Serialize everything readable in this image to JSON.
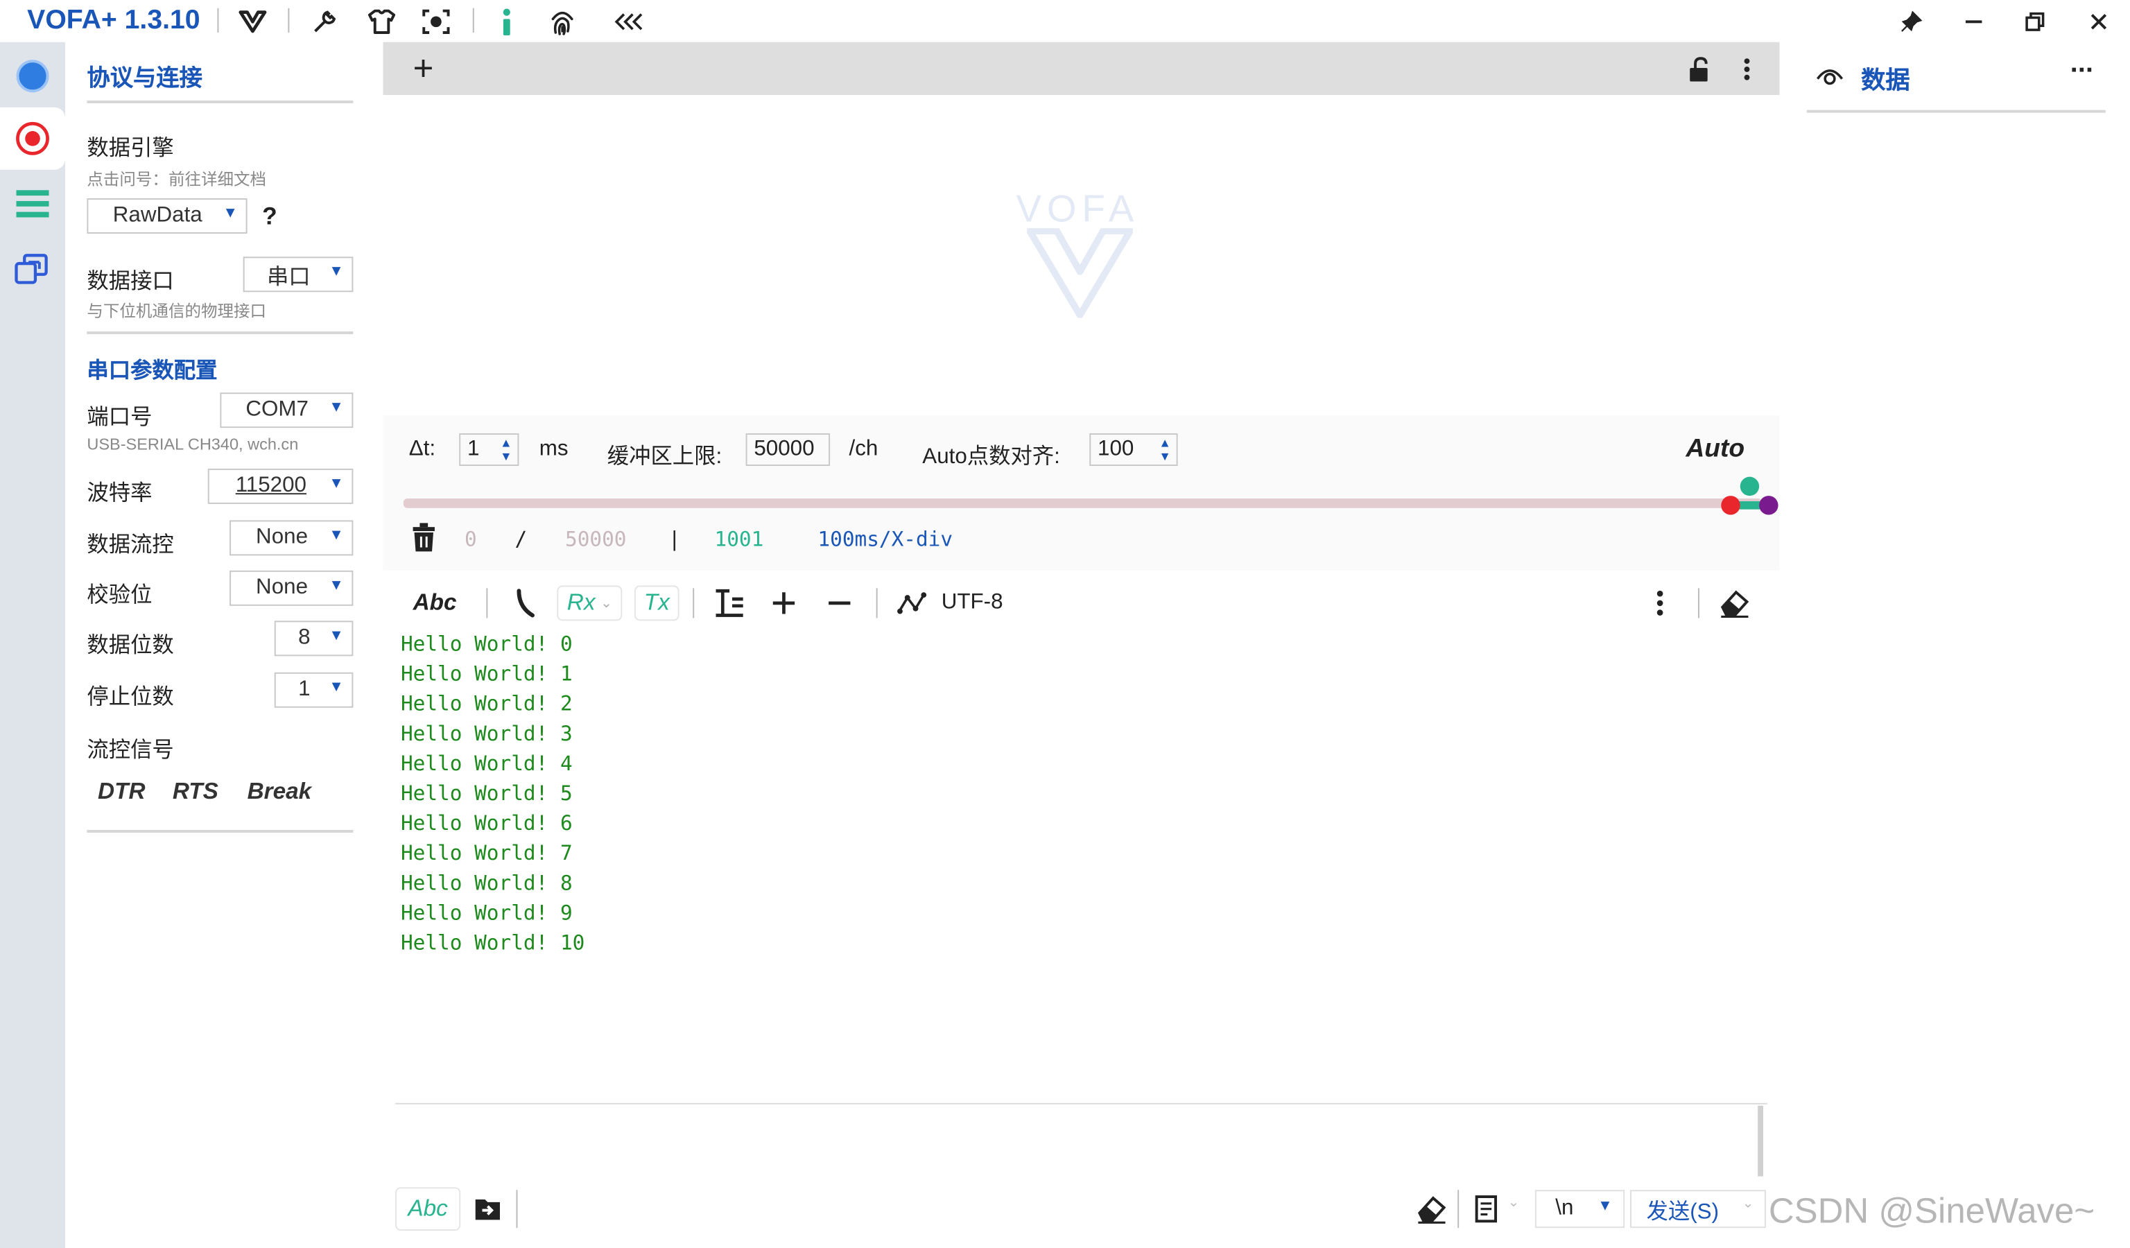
{
  "app": {
    "title": "VOFA+ 1.3.10"
  },
  "titlebar_icons": [
    "vofa-logo-icon",
    "wrench-icon",
    "shirt-icon",
    "camera-focus-icon",
    "info-icon",
    "fingerprint-icon",
    "collapse-icon"
  ],
  "window_controls": [
    "pin-icon",
    "minimize-icon",
    "restore-icon",
    "close-icon"
  ],
  "left": {
    "section_title": "协议与连接",
    "engine": {
      "label": "数据引擎",
      "hint": "点击问号：前往详细文档",
      "value": "RawData",
      "help": "?"
    },
    "interface": {
      "label": "数据接口",
      "value": "串口",
      "hint": "与下位机通信的物理接口"
    },
    "serial_title": "串口参数配置",
    "port": {
      "label": "端口号",
      "value": "COM7",
      "hint": "USB-SERIAL CH340, wch.cn"
    },
    "baud": {
      "label": "波特率",
      "value": "115200"
    },
    "flow": {
      "label": "数据流控",
      "value": "None"
    },
    "parity": {
      "label": "校验位",
      "value": "None"
    },
    "databits": {
      "label": "数据位数",
      "value": "8"
    },
    "stopbits": {
      "label": "停止位数",
      "value": "1"
    },
    "signals": {
      "label": "流控信号",
      "dtr": "DTR",
      "rts": "RTS",
      "brk": "Break"
    }
  },
  "graph": {
    "add": "+",
    "watermark": "VOFA",
    "dt_label": "Δt:",
    "dt_value": "1",
    "dt_unit": "ms",
    "buffer_label": "缓冲区上限:",
    "buffer_value": "50000",
    "buffer_unit": "/ch",
    "align_label": "Auto点数对齐:",
    "align_value": "100",
    "auto": "Auto",
    "progress": 1.0,
    "status": {
      "count": "0",
      "slash": "/",
      "max": "50000",
      "bar": "|",
      "points": "1001",
      "div": "100ms/X-div"
    }
  },
  "terminal": {
    "toolbar": {
      "abc": "Abc",
      "rx": "Rx",
      "tx": "Tx",
      "encoding": "UTF-8"
    },
    "lines": [
      "Hello World! 0",
      "Hello World! 1",
      "Hello World! 2",
      "Hello World! 3",
      "Hello World! 4",
      "Hello World! 5",
      "Hello World! 6",
      "Hello World! 7",
      "Hello World! 8",
      "Hello World! 9",
      "Hello World! 10"
    ],
    "send_bar": {
      "abc": "Abc",
      "newline": "\\n",
      "send": "发送(S)"
    }
  },
  "right": {
    "title": "数据",
    "more": "···"
  },
  "watermark": "CSDN @SineWave~",
  "colors": {
    "accent": "#1a56b8",
    "green_text": "#1e8a1e",
    "teal": "#27b48f",
    "red": "#e8262b",
    "purple": "#7a1a8f"
  }
}
